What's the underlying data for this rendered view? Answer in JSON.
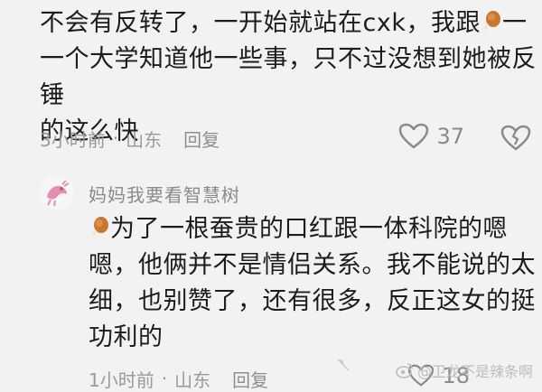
{
  "comment1": {
    "lines": [
      "不会有反转了，一开始就站在cxk，我跟",
      "一个大学知道他一些事，只不过没想到她被反锤",
      "的这么快"
    ],
    "time": "3小时前",
    "dot": "·",
    "location": "山东",
    "reply_label": "回复",
    "like_count": "37"
  },
  "comment2": {
    "username": "妈妈我要看智慧树",
    "lines": [
      "为了一根蚕贵的口红跟一体科院的嗯",
      "嗯，他俩并不是情侣关系。我不能说的太",
      "细，也别赞了，还有很多，反正这女的挺",
      "功利的"
    ],
    "time": "1小时前",
    "dot": "·",
    "location": "山东",
    "reply_label": "回复",
    "like_count": "18"
  },
  "watermark": {
    "text": "@卫龙不是辣条啊"
  },
  "colors": {
    "background": "#f2f2f2",
    "text": "#1c1c1c",
    "meta": "#9a9a9a",
    "drumstick": "#c9772f"
  }
}
